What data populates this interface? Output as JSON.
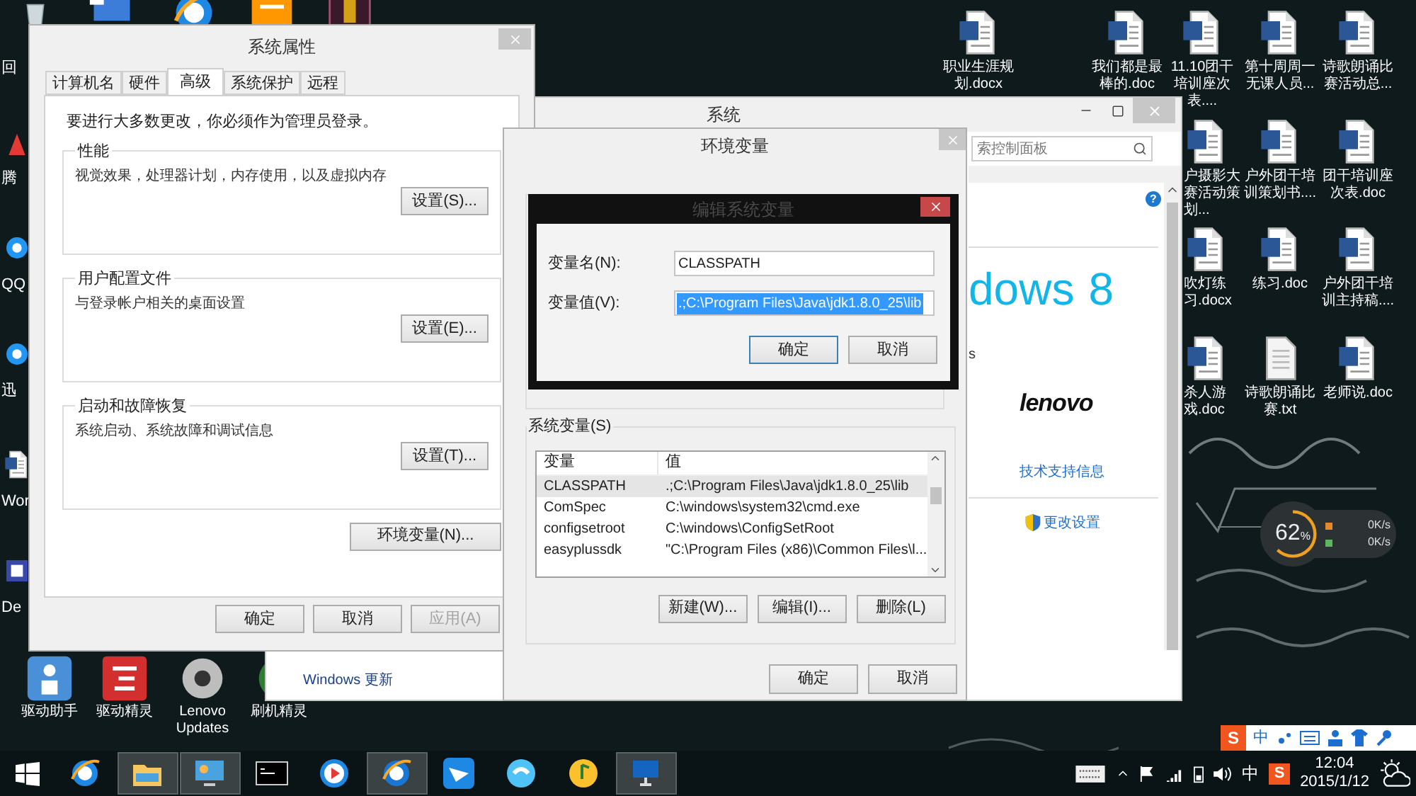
{
  "desktop": {
    "top_icons": [
      {
        "kind": "computer"
      },
      {
        "kind": "ie"
      },
      {
        "kind": "taobao"
      },
      {
        "kind": "game"
      }
    ],
    "left_icons": [
      {
        "kind": "recycle",
        "label": "回"
      },
      {
        "kind": "tencent",
        "label": "腾"
      },
      {
        "kind": "qq",
        "label": "QQ"
      },
      {
        "kind": "xunlei",
        "label": "迅"
      },
      {
        "kind": "word",
        "label": "Wor"
      },
      {
        "kind": "app",
        "label": "De"
      }
    ],
    "bottom_icons": [
      {
        "kind": "driver",
        "label": "驱动助手"
      },
      {
        "kind": "driver2",
        "label": "驱动精灵"
      },
      {
        "kind": "lenovo",
        "label": "Lenovo Updates"
      },
      {
        "kind": "phone",
        "label": "刷机精灵"
      }
    ],
    "right_icons": [
      {
        "kind": "word",
        "label": "职业生涯规划.docx"
      },
      {
        "kind": "word",
        "label": "我们都是最棒的.doc"
      },
      {
        "kind": "word",
        "label": "11.10团干培训座次表...."
      },
      {
        "kind": "word",
        "label": "第十周周一无课人员..."
      },
      {
        "kind": "word",
        "label": "诗歌朗诵比赛活动总..."
      },
      {
        "kind": "word",
        "label": "户摄影大赛活动策划..."
      },
      {
        "kind": "word",
        "label": "户外团干培训策划书...."
      },
      {
        "kind": "word",
        "label": "团干培训座次表.doc"
      },
      {
        "kind": "word",
        "label": "吹灯练习.docx"
      },
      {
        "kind": "word",
        "label": "练习.doc"
      },
      {
        "kind": "word",
        "label": "户外团干培训主持稿...."
      },
      {
        "kind": "word",
        "label": "杀人游戏.doc"
      },
      {
        "kind": "txt",
        "label": "诗歌朗诵比赛.txt"
      },
      {
        "kind": "word",
        "label": "老师说.doc"
      }
    ]
  },
  "system_window": {
    "title": "系统",
    "search_placeholder": "索控制面板",
    "help": "?",
    "logo_text": "dows",
    "logo_version": "8",
    "cut_text": "s",
    "brand": "lenovo",
    "support_link": "技术支持信息",
    "change_link": "更改设置",
    "sidebar_links": [
      "Windows 更新"
    ]
  },
  "system_properties": {
    "title": "系统属性",
    "tabs": [
      {
        "label": "计算机名",
        "selected": false
      },
      {
        "label": "硬件",
        "selected": false
      },
      {
        "label": "高级",
        "selected": true
      },
      {
        "label": "系统保护",
        "selected": false
      },
      {
        "label": "远程",
        "selected": false
      }
    ],
    "notice": "要进行大多数更改，你必须作为管理员登录。",
    "groups": [
      {
        "title": "性能",
        "description": "视觉效果，处理器计划，内存使用，以及虚拟内存",
        "button": "设置(S)..."
      },
      {
        "title": "用户配置文件",
        "description": "与登录帐户相关的桌面设置",
        "button": "设置(E)..."
      },
      {
        "title": "启动和故障恢复",
        "description": "系统启动、系统故障和调试信息",
        "button": "设置(T)..."
      }
    ],
    "env_button": "环境变量(N)...",
    "buttons": [
      {
        "label": "确定",
        "disabled": false
      },
      {
        "label": "取消",
        "disabled": false
      },
      {
        "label": "应用(A)",
        "disabled": true
      }
    ]
  },
  "environment_variables": {
    "title": "环境变量",
    "system_group": "系统变量(S)",
    "columns": [
      "变量",
      "值"
    ],
    "rows": [
      {
        "name": "CLASSPATH",
        "value": ".;C:\\Program Files\\Java\\jdk1.8.0_25\\lib",
        "selected": true
      },
      {
        "name": "ComSpec",
        "value": "C:\\windows\\system32\\cmd.exe",
        "selected": false
      },
      {
        "name": "configsetroot",
        "value": "C:\\windows\\ConfigSetRoot",
        "selected": false
      },
      {
        "name": "easyplussdk",
        "value": "\"C:\\Program Files (x86)\\Common Files\\l...",
        "selected": false
      }
    ],
    "list_buttons": [
      "新建(W)...",
      "编辑(I)...",
      "删除(L)"
    ],
    "buttons": [
      "确定",
      "取消"
    ]
  },
  "edit_dialog": {
    "title": "编辑系统变量",
    "fields": [
      {
        "label": "变量名(N):",
        "value": "CLASSPATH",
        "selected": false
      },
      {
        "label": "变量值(V):",
        "value": ".;C:\\Program Files\\Java\\jdk1.8.0_25\\lib",
        "selected": true
      }
    ],
    "buttons": [
      {
        "label": "确定",
        "default": true
      },
      {
        "label": "取消",
        "default": false
      }
    ]
  },
  "widget": {
    "percent": "62",
    "unit": "%",
    "level": 0.62,
    "speeds": [
      "0K/s",
      "0K/s"
    ]
  },
  "ime_bar": {
    "logo": "S",
    "mode": "中"
  },
  "taskbar": {
    "apps": [
      {
        "kind": "ie",
        "active": false
      },
      {
        "kind": "explorer",
        "active": true
      },
      {
        "kind": "control",
        "active": true
      },
      {
        "kind": "cmd",
        "active": false
      },
      {
        "kind": "video",
        "active": false
      },
      {
        "kind": "browser",
        "active": true
      },
      {
        "kind": "bird",
        "active": false
      },
      {
        "kind": "chat",
        "active": false
      },
      {
        "kind": "music",
        "active": false
      },
      {
        "kind": "system",
        "active": true
      }
    ],
    "ime": "中",
    "ime_logo": "S",
    "time": "12:04",
    "date": "2015/1/12"
  }
}
